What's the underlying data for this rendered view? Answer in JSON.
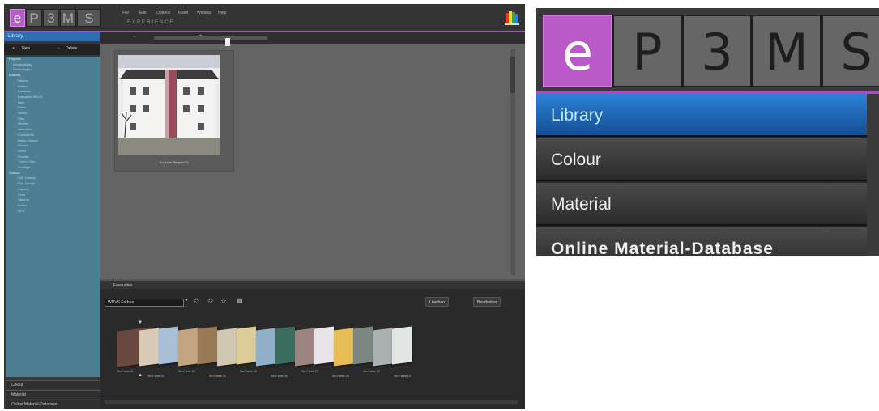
{
  "app": {
    "logo_letters": [
      "e",
      "P",
      "3",
      "M",
      "S"
    ],
    "menu": [
      "File",
      "Edit",
      "Options",
      "Insert",
      "Window",
      "Help"
    ],
    "project_title": "EXPERIENCE",
    "colors": {
      "accent": "#b45ec4",
      "active_tab": "#2d6fb0",
      "tree_bg": "#4c7f93"
    }
  },
  "sidebar": {
    "header": "Library",
    "new_label": "New",
    "delete_label": "Delete",
    "tree": [
      {
        "label": "Projects",
        "level": 0
      },
      {
        "label": "Bestandsbau",
        "level": 1
      },
      {
        "label": "Sanierungen",
        "level": 1
      },
      {
        "label": "Material",
        "level": 0
      },
      {
        "label": "Dächer",
        "level": 2
      },
      {
        "label": "Böden",
        "level": 2
      },
      {
        "label": "Fassaden",
        "level": 2
      },
      {
        "label": "Fassaden WDVS",
        "level": 2
      },
      {
        "label": "Holz",
        "level": 2
      },
      {
        "label": "Putze",
        "level": 2
      },
      {
        "label": "Steine",
        "level": 2
      },
      {
        "label": "Glas",
        "level": 2
      },
      {
        "label": "Metalle",
        "level": 2
      },
      {
        "label": "Naturstein",
        "level": 2
      },
      {
        "label": "Kunststoffe",
        "level": 2
      },
      {
        "label": "Beton / Ziegel",
        "level": 2
      },
      {
        "label": "Fliesen",
        "level": 2
      },
      {
        "label": "Innen",
        "level": 2
      },
      {
        "label": "Fenster",
        "level": 2
      },
      {
        "label": "Türen / Tore",
        "level": 2
      },
      {
        "label": "Sonstige",
        "level": 2
      },
      {
        "label": "Colours",
        "level": 0
      },
      {
        "label": "RAL Classic",
        "level": 2
      },
      {
        "label": "RAL Design",
        "level": 2
      },
      {
        "label": "Caparol",
        "level": 2
      },
      {
        "label": "Keim",
        "level": 2
      },
      {
        "label": "Sikkens",
        "level": 2
      },
      {
        "label": "Brillux",
        "level": 2
      },
      {
        "label": "NCS",
        "level": 2
      }
    ],
    "bottom_tabs": [
      "Colour",
      "Material",
      "Online Material-Database"
    ]
  },
  "content": {
    "image_label": "Fassade Beispiel 01"
  },
  "favorites": {
    "header": "Favourites",
    "set_name": "WDVS Farben",
    "load_label": "Löschen",
    "save_label": "Bearbeiten",
    "swatch_colors": [
      "#6a4840",
      "#d9cbb6",
      "#a9bfd6",
      "#c3a581",
      "#9a7a56",
      "#cfc7b2",
      "#dccc98",
      "#8fb0c6",
      "#3b6d5e",
      "#9c8580",
      "#e8e4e8",
      "#e5bd52",
      "#7b8982",
      "#a9b2b0",
      "#e2e6e3"
    ],
    "swatch_labels": [
      "Sto Farbe 01",
      "Sto Farbe 02",
      "Sto Farbe 03",
      "Sto Farbe 04",
      "Sto Farbe 05",
      "Sto Farbe 06",
      "Sto Farbe 07",
      "Sto Farbe 08",
      "Sto Farbe 09",
      "Sto Farbe 10"
    ]
  },
  "zoom": {
    "letters": [
      "e",
      "P",
      "3",
      "M",
      "S"
    ],
    "menu": [
      "Library",
      "Colour",
      "Material",
      "Online Material-Database"
    ]
  }
}
